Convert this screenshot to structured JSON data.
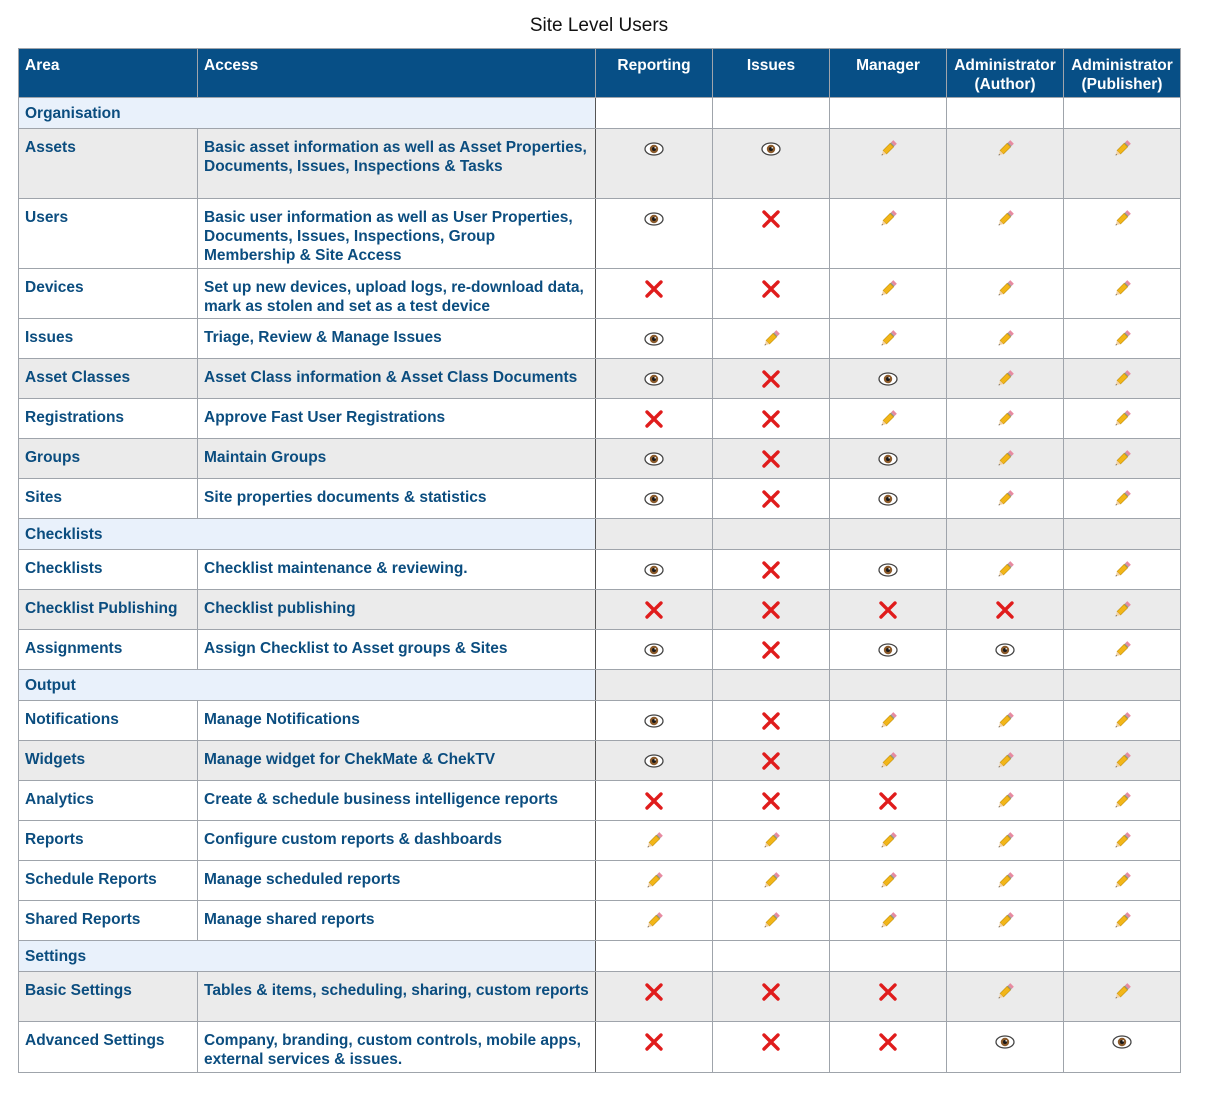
{
  "title": "Site Level Users",
  "headers": {
    "area": "Area",
    "access": "Access",
    "roles": [
      {
        "line1": "Reporting",
        "line2": ""
      },
      {
        "line1": "Issues",
        "line2": ""
      },
      {
        "line1": "Manager",
        "line2": ""
      },
      {
        "line1": "Administrator",
        "line2": "(Author)"
      },
      {
        "line1": "Administrator",
        "line2": "(Publisher)"
      }
    ]
  },
  "legend_icons": {
    "V": "eye-icon",
    "E": "pencil-icon",
    "X": "cross-icon"
  },
  "sections": [
    {
      "name": "Organisation",
      "section_shaded": false,
      "rows": [
        {
          "area": "Assets",
          "access": "Basic asset information as well as Asset Properties, Documents, Issues, Inspections & Tasks",
          "perms": [
            "V",
            "V",
            "E",
            "E",
            "E"
          ],
          "h": 70
        },
        {
          "area": "Users",
          "access": "Basic user information as well as User Properties, Documents, Issues, Inspections, Group Membership & Site Access",
          "perms": [
            "V",
            "X",
            "E",
            "E",
            "E"
          ],
          "h": 70
        },
        {
          "area": "Devices",
          "access": "Set up new devices, upload logs, re-download data, mark as stolen and set as a test device",
          "perms": [
            "X",
            "X",
            "E",
            "E",
            "E"
          ],
          "h": 50
        },
        {
          "area": "Issues",
          "access": "Triage, Review & Manage Issues",
          "perms": [
            "V",
            "E",
            "E",
            "E",
            "E"
          ],
          "h": 40
        },
        {
          "area": "Asset Classes",
          "access": "Asset Class information & Asset Class Documents",
          "perms": [
            "V",
            "X",
            "V",
            "E",
            "E"
          ],
          "h": 40
        },
        {
          "area": "Registrations",
          "access": "Approve Fast User Registrations",
          "perms": [
            "X",
            "X",
            "E",
            "E",
            "E"
          ],
          "h": 40
        },
        {
          "area": "Groups",
          "access": "Maintain Groups",
          "perms": [
            "V",
            "X",
            "V",
            "E",
            "E"
          ],
          "h": 40
        },
        {
          "area": "Sites",
          "access": "Site properties documents & statistics",
          "perms": [
            "V",
            "X",
            "V",
            "E",
            "E"
          ],
          "h": 40
        }
      ]
    },
    {
      "name": "Checklists",
      "section_shaded": true,
      "rows": [
        {
          "area": "Checklists",
          "access": "Checklist maintenance & reviewing.",
          "perms": [
            "V",
            "X",
            "V",
            "E",
            "E"
          ],
          "h": 40
        },
        {
          "area": "Checklist Publishing",
          "access": "Checklist publishing",
          "perms": [
            "X",
            "X",
            "X",
            "X",
            "E"
          ],
          "h": 40
        },
        {
          "area": "Assignments",
          "access": "Assign Checklist to Asset groups & Sites",
          "perms": [
            "V",
            "X",
            "V",
            "V",
            "E"
          ],
          "h": 40
        }
      ]
    },
    {
      "name": "Output",
      "section_shaded": true,
      "rows": [
        {
          "area": "Notifications",
          "access": "Manage Notifications",
          "perms": [
            "V",
            "X",
            "E",
            "E",
            "E"
          ],
          "h": 40
        },
        {
          "area": "Widgets",
          "access": "Manage widget for ChekMate & ChekTV",
          "perms": [
            "V",
            "X",
            "E",
            "E",
            "E"
          ],
          "h": 40
        },
        {
          "area": "Analytics",
          "access": "Create & schedule business intelligence reports",
          "perms": [
            "X",
            "X",
            "X",
            "E",
            "E"
          ],
          "h": 40
        },
        {
          "area": "Reports",
          "access": "Configure custom reports & dashboards",
          "perms": [
            "E",
            "E",
            "E",
            "E",
            "E"
          ],
          "h": 40
        },
        {
          "area": "Schedule Reports",
          "access": "Manage scheduled reports",
          "perms": [
            "E",
            "E",
            "E",
            "E",
            "E"
          ],
          "h": 40
        },
        {
          "area": "Shared Reports",
          "access": "Manage shared reports",
          "perms": [
            "E",
            "E",
            "E",
            "E",
            "E"
          ],
          "h": 40
        }
      ]
    },
    {
      "name": "Settings",
      "section_shaded": false,
      "rows": [
        {
          "area": "Basic Settings",
          "access": "Tables & items, scheduling, sharing, custom reports",
          "perms": [
            "X",
            "X",
            "X",
            "E",
            "E"
          ],
          "h": 50
        },
        {
          "area": "Advanced Settings",
          "access": "Company, branding, custom controls, mobile apps, external services & issues.",
          "perms": [
            "X",
            "X",
            "X",
            "V",
            "V"
          ],
          "h": 51
        }
      ]
    }
  ]
}
